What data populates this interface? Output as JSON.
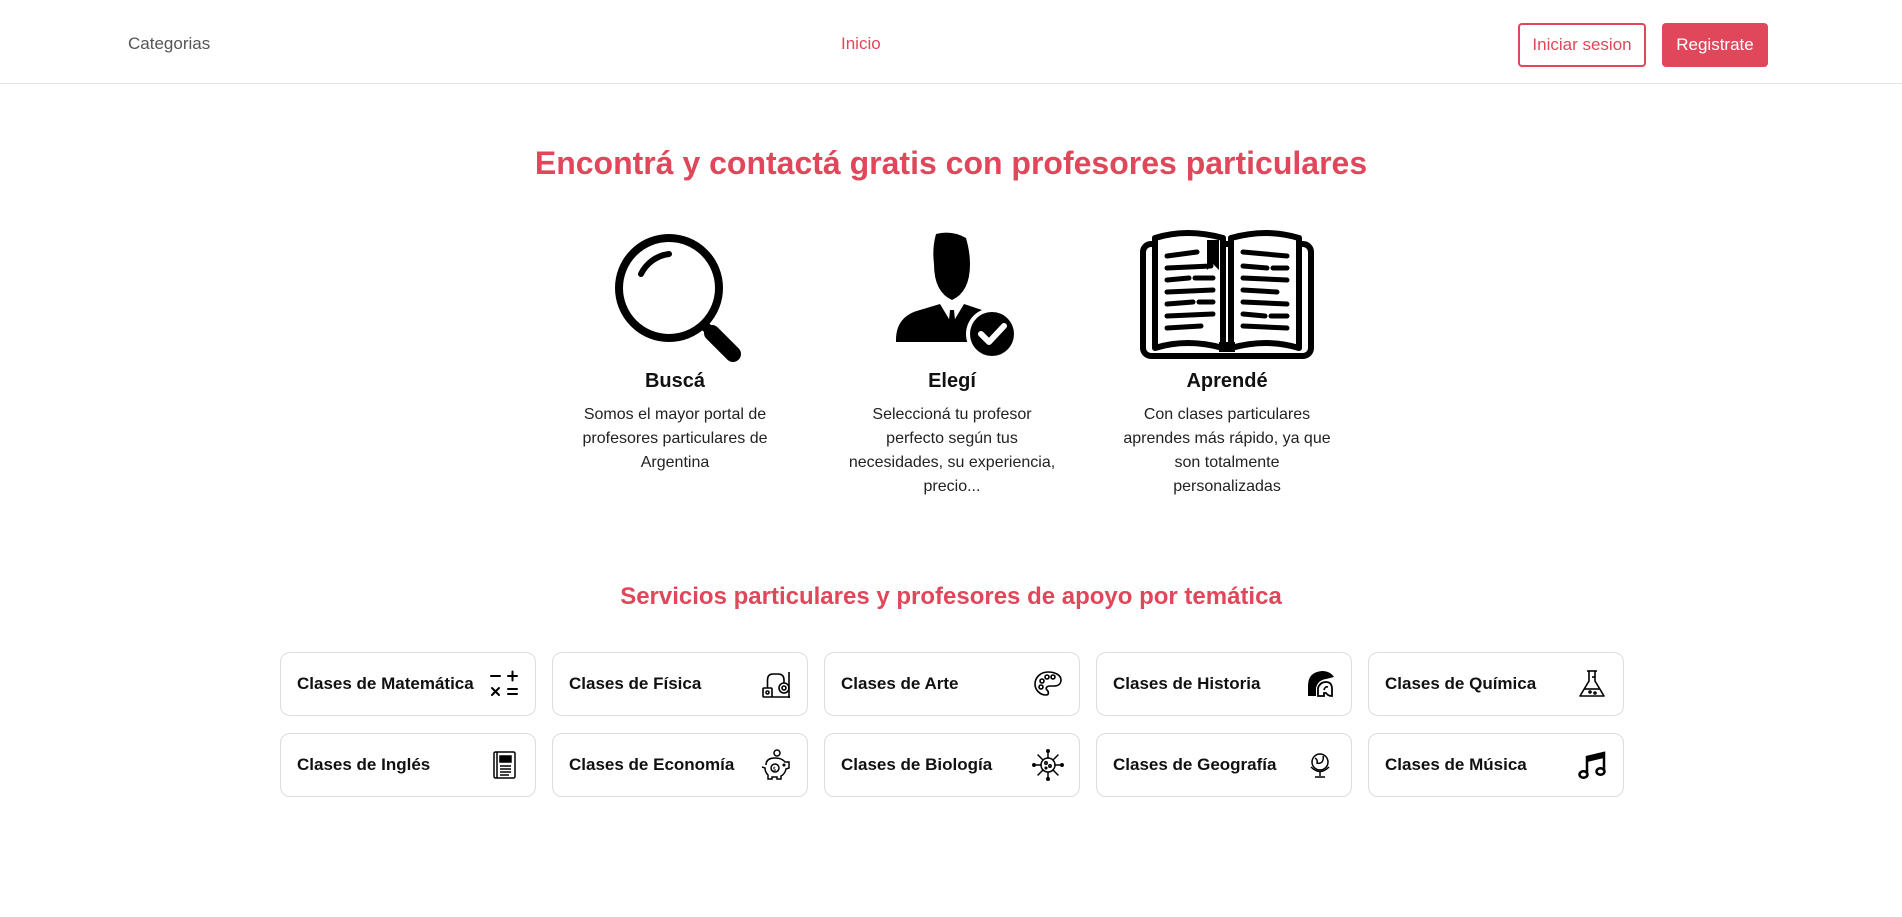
{
  "nav": {
    "categorias": "Categorias",
    "inicio": "Inicio",
    "login": "Iniciar sesion",
    "register": "Registrate"
  },
  "colors": {
    "accent": "#e0475a"
  },
  "hero": {
    "title": "Encontrá y contactá gratis con profesores particulares",
    "steps": [
      {
        "icon": "magnifier-icon",
        "title": "Buscá",
        "text": "Somos el mayor portal de profesores particulares de Argentina"
      },
      {
        "icon": "person-check-icon",
        "title": "Elegí",
        "text": "Seleccioná tu profesor perfecto según tus necesidades, su experiencia, precio..."
      },
      {
        "icon": "open-book-icon",
        "title": "Aprendé",
        "text": "Con clases particulares aprendes más rápido, ya que son totalmente personalizadas"
      }
    ]
  },
  "services": {
    "title": "Servicios particulares y profesores de apoyo por temática",
    "cards": [
      {
        "label": "Clases de Matemática",
        "icon": "math-operators-icon"
      },
      {
        "label": "Clases de Física",
        "icon": "physics-icon"
      },
      {
        "label": "Clases de Arte",
        "icon": "palette-icon"
      },
      {
        "label": "Clases de Historia",
        "icon": "spartan-helmet-icon"
      },
      {
        "label": "Clases de Química",
        "icon": "flask-icon"
      },
      {
        "label": "Clases de Inglés",
        "icon": "english-book-icon"
      },
      {
        "label": "Clases de Economía",
        "icon": "piggy-bank-icon"
      },
      {
        "label": "Clases de Biología",
        "icon": "virus-icon"
      },
      {
        "label": "Clases de Geografía",
        "icon": "globe-icon"
      },
      {
        "label": "Clases de Música",
        "icon": "music-note-icon"
      }
    ]
  }
}
